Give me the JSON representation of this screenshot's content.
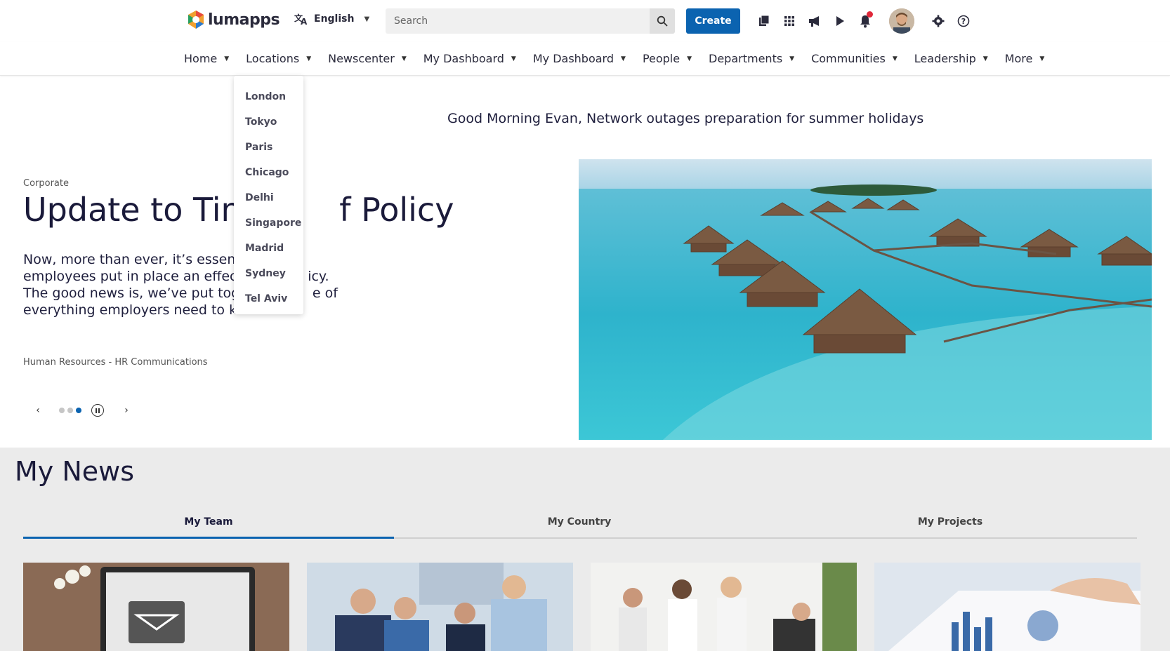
{
  "app": {
    "brand": "lumapps",
    "brand_color": "#0b63b0"
  },
  "topbar": {
    "language": "English",
    "search_placeholder": "Search",
    "create_label": "Create",
    "icons": [
      "library-icon",
      "apps-grid-icon",
      "megaphone-icon",
      "play-icon",
      "bell-icon",
      "avatar",
      "gear-icon",
      "help-icon"
    ],
    "notification_dot_color": "#e0283a"
  },
  "nav": {
    "items": [
      {
        "label": "Home"
      },
      {
        "label": "Locations"
      },
      {
        "label": "Newscenter"
      },
      {
        "label": "My Dashboard"
      },
      {
        "label": "My Dashboard"
      },
      {
        "label": "People"
      },
      {
        "label": "Departments"
      },
      {
        "label": "Communities"
      },
      {
        "label": "Leadership"
      },
      {
        "label": "More"
      }
    ]
  },
  "locations_dropdown": {
    "items": [
      "London",
      "Tokyo",
      "Paris",
      "Chicago",
      "Delhi",
      "Singapore",
      "Madrid",
      "Sydney",
      "Tel Aviv"
    ]
  },
  "greeting": "Good Morning Evan,  Network outages preparation for summer holidays",
  "hero": {
    "category": "Corporate",
    "title_visible": "Update to Tim",
    "title_tail": "f Policy",
    "body_lines": [
      "Now, more than ever, it’s essentia",
      "employees put in place an effecti",
      "The good news is, we’ve put toge",
      "everything employers need to kn"
    ],
    "body_tails": [
      "",
      "icy.",
      "e of",
      ""
    ],
    "meta": "Human Resources - HR Communications",
    "carousel": {
      "slides": 3,
      "active_index": 2
    }
  },
  "news": {
    "title": "My News",
    "tabs": [
      {
        "label": "My Team",
        "active": true
      },
      {
        "label": "My Country",
        "active": false
      },
      {
        "label": "My Projects",
        "active": false
      }
    ]
  }
}
